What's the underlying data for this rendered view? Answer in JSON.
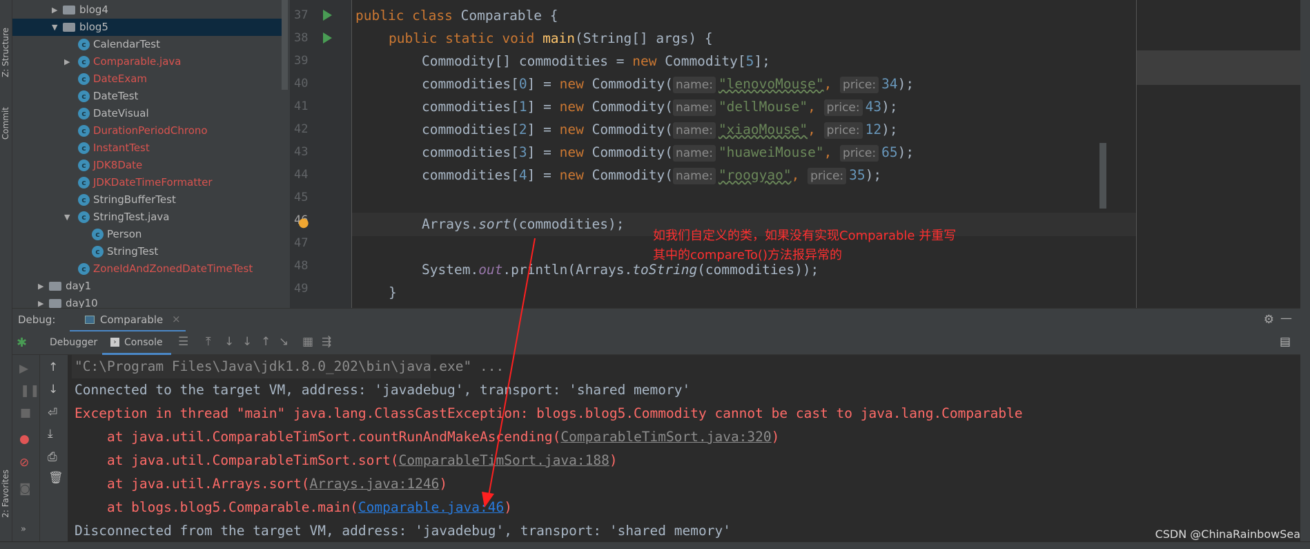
{
  "left_stripe": {
    "structure": "Z: Structure",
    "commit": "Commit",
    "favorites": "2: Favorites"
  },
  "project_tree": [
    {
      "label": "blog4",
      "type": "folder",
      "expanded": false,
      "depth": 0,
      "color": "normal"
    },
    {
      "label": "blog5",
      "type": "folder",
      "expanded": true,
      "depth": 0,
      "color": "normal",
      "selected": true
    },
    {
      "label": "CalendarTest",
      "type": "class",
      "depth": 1,
      "color": "normal"
    },
    {
      "label": "Comparable.java",
      "type": "class",
      "depth": 1,
      "color": "red",
      "collapsed": true
    },
    {
      "label": "DateExam",
      "type": "class",
      "depth": 1,
      "color": "red"
    },
    {
      "label": "DateTest",
      "type": "class",
      "depth": 1,
      "color": "normal"
    },
    {
      "label": "DateVisual",
      "type": "class",
      "depth": 1,
      "color": "normal"
    },
    {
      "label": "DurationPeriodChrono",
      "type": "class",
      "depth": 1,
      "color": "red"
    },
    {
      "label": "InstantTest",
      "type": "class",
      "depth": 1,
      "color": "red"
    },
    {
      "label": "JDK8Date",
      "type": "class",
      "depth": 1,
      "color": "red"
    },
    {
      "label": "JDKDateTimeFormatter",
      "type": "class",
      "depth": 1,
      "color": "red"
    },
    {
      "label": "StringBufferTest",
      "type": "class",
      "depth": 1,
      "color": "normal"
    },
    {
      "label": "StringTest.java",
      "type": "class",
      "depth": 1,
      "color": "normal",
      "expanded": true
    },
    {
      "label": "Person",
      "type": "class",
      "depth": 2,
      "color": "normal"
    },
    {
      "label": "StringTest",
      "type": "class",
      "depth": 2,
      "color": "normal"
    },
    {
      "label": "ZoneIdAndZonedDateTimeTest",
      "type": "class",
      "depth": 1,
      "color": "red"
    },
    {
      "label": "day1",
      "type": "folder",
      "expanded": false,
      "depth": -1,
      "color": "normal"
    },
    {
      "label": "day10",
      "type": "folder",
      "expanded": false,
      "depth": -1,
      "color": "normal"
    }
  ],
  "editor": {
    "line_numbers": [
      "37",
      "38",
      "39",
      "40",
      "41",
      "42",
      "43",
      "44",
      "45",
      "46",
      "47",
      "48",
      "49"
    ],
    "l37": {
      "kw": "public class ",
      "name": "Comparable {"
    },
    "l38": {
      "kw": "public static void ",
      "name": "main",
      "rest": "(String[] args) {"
    },
    "l39": {
      "a": "Commodity[] commodities = ",
      "kw": "new ",
      "b": "Commodity[",
      "n": "5",
      "c": "];"
    },
    "commodity_rows": [
      {
        "index": "0",
        "name": "\"lenovoMouse\"",
        "price": "34"
      },
      {
        "index": "1",
        "name": "\"dellMouse\"",
        "price": "43"
      },
      {
        "index": "2",
        "name": "\"xiaoMouse\"",
        "price": "12"
      },
      {
        "index": "3",
        "name": "\"huaweiMouse\"",
        "price": "65"
      },
      {
        "index": "4",
        "name": "\"roogyao\"",
        "price": "35"
      }
    ],
    "hint_name": "name:",
    "hint_price": "price:",
    "row_prefix": "commodities[",
    "row_mid": "] = ",
    "kw_new": "new ",
    "row_ctor": "Commodity(",
    "l46": {
      "a": "Arrays.",
      "m": "sort",
      "b": "(commodities);"
    },
    "l48": {
      "a": "System.",
      "f": "out",
      "b": ".println(Arrays.",
      "m": "toString",
      "c": "(commodities));"
    },
    "l49": "}"
  },
  "annotation": {
    "line1": "如我们自定义的类，如果没有实现Comparable 并重写",
    "line2": "其中的compareTo()方法报异常的",
    "color": "#ff3030"
  },
  "debug": {
    "label": "Debug:",
    "tab": "Comparable",
    "debugger_tab": "Debugger",
    "console_tab": "Console"
  },
  "console": {
    "cmd": "\"C:\\Program Files\\Java\\jdk1.8.0_202\\bin\\java.exe\" ...",
    "connected": "Connected to the target VM, address: 'javadebug', transport: 'shared memory'",
    "exception": "Exception in thread \"main\" java.lang.ClassCastException: blogs.blog5.Commodity cannot be cast to java.lang.Comparable",
    "trace": [
      {
        "at": "    at java.util.ComparableTimSort.countRunAndMakeAscending(",
        "link": "ComparableTimSort.java:320",
        "end": ")"
      },
      {
        "at": "    at java.util.ComparableTimSort.sort(",
        "link": "ComparableTimSort.java:188",
        "end": ")"
      },
      {
        "at": "    at java.util.Arrays.sort(",
        "link": "Arrays.java:1246",
        "end": ")"
      },
      {
        "at": "    at blogs.blog5.Comparable.main(",
        "link": "Comparable.java:46",
        "end": ")"
      }
    ],
    "disconnected": "Disconnected from the target VM, address: 'javadebug', transport: 'shared memory'"
  },
  "watermark": "CSDN @ChinaRainbowSea"
}
